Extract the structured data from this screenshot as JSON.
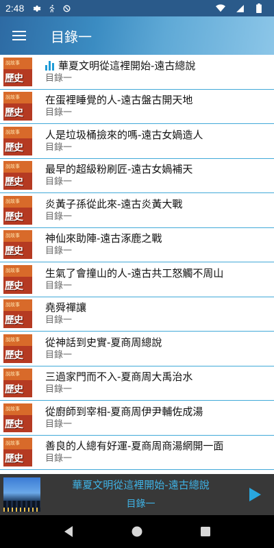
{
  "status_bar": {
    "time": "2:48",
    "icons": [
      "settings-icon",
      "running-icon",
      "data-saver-icon",
      "wifi-icon",
      "signal-icon",
      "battery-icon"
    ]
  },
  "app_bar": {
    "title": "目錄一",
    "menu_icon": "hamburger-menu-icon"
  },
  "list": {
    "items": [
      {
        "title": "華夏文明從這裡開始-遠古總說",
        "subtitle": "目錄一",
        "playing": true
      },
      {
        "title": "在蛋裡睡覺的人-遠古盤古開天地",
        "subtitle": "目錄一"
      },
      {
        "title": "人是垃圾桶撿來的嗎-遠古女媧造人",
        "subtitle": "目錄一"
      },
      {
        "title": "最早的超級粉刷匠-遠古女媧補天",
        "subtitle": "目錄一"
      },
      {
        "title": "炎黃子孫從此來-遠古炎黃大戰",
        "subtitle": "目錄一"
      },
      {
        "title": "神仙來助陣-遠古涿鹿之戰",
        "subtitle": "目錄一"
      },
      {
        "title": "生氣了會撞山的人-遠古共工怒觸不周山",
        "subtitle": "目錄一"
      },
      {
        "title": "堯舜禪讓",
        "subtitle": "目錄一"
      },
      {
        "title": "從神話到史實-夏商周總說",
        "subtitle": "目錄一"
      },
      {
        "title": "三過家門而不入-夏商周大禹治水",
        "subtitle": "目錄一"
      },
      {
        "title": "從廚師到宰相-夏商周伊尹輔佐成湯",
        "subtitle": "目錄一"
      },
      {
        "title": "善良的人總有好運-夏商周商湯網開一面",
        "subtitle": "目錄一"
      }
    ],
    "thumb_text": "歷史",
    "thumb_small": "說故事"
  },
  "player": {
    "title": "華夏文明從這裡開始-遠古總說",
    "subtitle": "目錄一",
    "play_icon": "play-icon"
  },
  "nav_bar": {
    "icons": [
      "back-icon",
      "home-icon",
      "recents-icon"
    ]
  },
  "colors": {
    "accent": "#1e9bd7",
    "divider": "#3fa8d8",
    "player_bg": "#383838",
    "player_text": "#3fb3e6"
  }
}
